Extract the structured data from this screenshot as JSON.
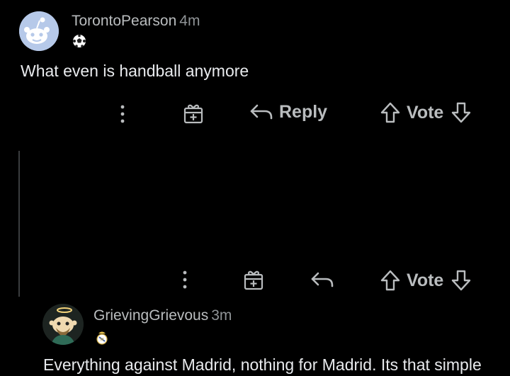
{
  "comments": [
    {
      "username": "TorontoPearson",
      "time": "4m",
      "avatar_icon": "reddit-snoo-avatar",
      "flair_icon": "soccer-ball-icon",
      "body": "What even is handball anymore",
      "actions": {
        "more_icon": "more-vertical-icon",
        "award_icon": "gift-award-icon",
        "reply_icon": "reply-arrow-icon",
        "reply_label": "Reply",
        "upvote_icon": "upvote-arrow-icon",
        "vote_label": "Vote",
        "downvote_icon": "downvote-arrow-icon"
      }
    },
    {
      "username": "GrievingGrievous",
      "time": "3m",
      "avatar_icon": "custom-snoo-avatar-halo",
      "flair_icon": "real-madrid-crest-icon",
      "body": "Everything against Madrid, nothing for Madrid. Its that simple",
      "actions": {
        "more_icon": "more-vertical-icon",
        "award_icon": "gift-award-icon",
        "reply_icon": "reply-arrow-icon",
        "upvote_icon": "upvote-arrow-icon",
        "vote_label": "Vote",
        "downvote_icon": "downvote-arrow-icon"
      }
    }
  ],
  "colors": {
    "background": "#000000",
    "text": "#e8eaed",
    "muted": "#b9bcbe",
    "thread_line": "#3a3c3e"
  }
}
